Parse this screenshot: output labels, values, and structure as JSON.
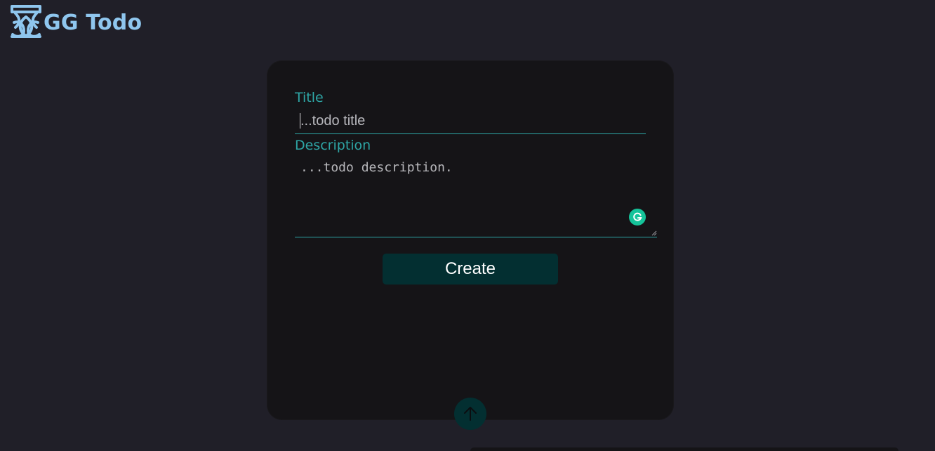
{
  "app": {
    "brand": "GG Todo"
  },
  "form": {
    "title_label": "Title",
    "title_placeholder": "...todo title",
    "title_value": "",
    "description_label": "Description",
    "description_placeholder": "...todo description.",
    "description_value": "",
    "create_label": "Create"
  },
  "icons": {
    "logo": "gg-logo-icon",
    "grammarly": "grammarly-icon",
    "scroll_top": "arrow-up-icon",
    "resize": "resize-handle-icon"
  },
  "colors": {
    "background": "#201f28",
    "card": "#151417",
    "accent": "#2ea6a6",
    "brand": "#8fc6ee",
    "button": "#032f31",
    "grammarly": "#15c39a"
  }
}
